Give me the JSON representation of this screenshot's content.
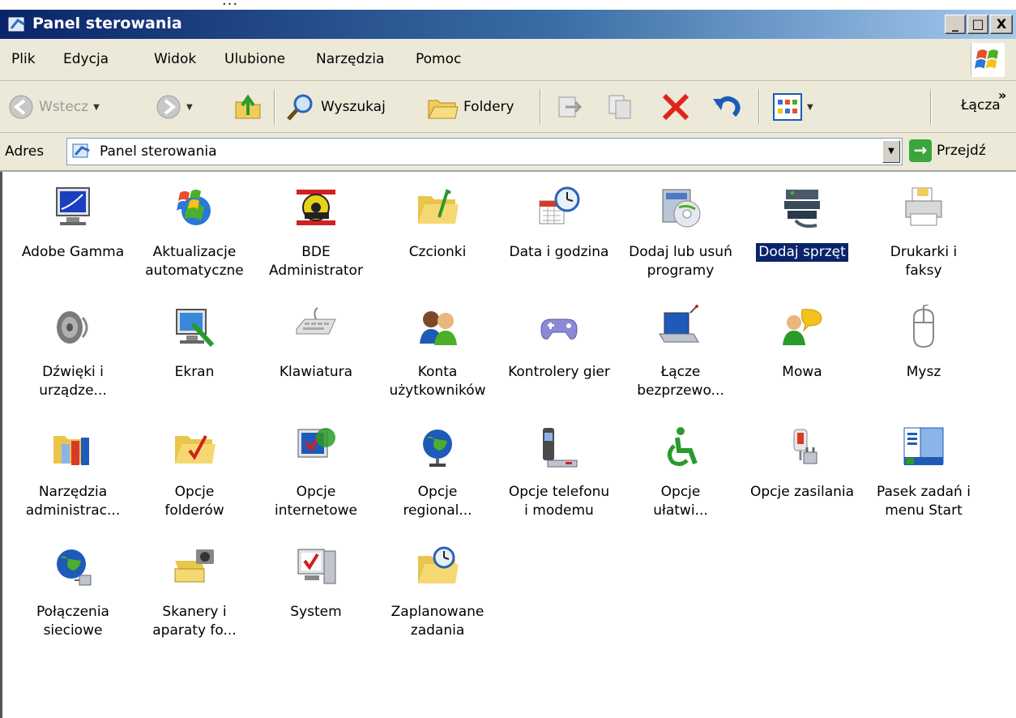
{
  "window": {
    "title": "Panel sterowania"
  },
  "window_controls": {
    "minimize": "_",
    "maximize": "□",
    "close": "X"
  },
  "menu": [
    "Plik",
    "Edycja",
    "Widok",
    "Ulubione",
    "Narzędzia",
    "Pomoc"
  ],
  "toolbar": {
    "back": "Wstecz",
    "search": "Wyszukaj",
    "folders": "Foldery",
    "links": "Łącza",
    "chevron": "»"
  },
  "address": {
    "label": "Adres",
    "value": "Panel sterowania",
    "go": "Przejdź"
  },
  "items": [
    {
      "label": "Adobe Gamma",
      "icon": "monitor-icon"
    },
    {
      "label": "Aktualizacje\nautomatyczne",
      "icon": "windows-update-icon"
    },
    {
      "label": "BDE\nAdministrator",
      "icon": "bde-gear-icon"
    },
    {
      "label": "Czcionki",
      "icon": "fonts-folder-icon"
    },
    {
      "label": "Data i godzina",
      "icon": "clock-calendar-icon"
    },
    {
      "label": "Dodaj lub usuń\nprogramy",
      "icon": "add-remove-programs-icon"
    },
    {
      "label": "Dodaj sprzęt",
      "icon": "hardware-icon",
      "selected": true
    },
    {
      "label": "Drukarki i\nfaksy",
      "icon": "printer-icon"
    },
    {
      "label": "Dźwięki i\nurządze...",
      "icon": "speaker-icon"
    },
    {
      "label": "Ekran",
      "icon": "display-icon"
    },
    {
      "label": "Klawiatura",
      "icon": "keyboard-icon"
    },
    {
      "label": "Konta\nużytkowników",
      "icon": "users-icon"
    },
    {
      "label": "Kontrolery gier",
      "icon": "gamepad-icon"
    },
    {
      "label": "Łącze\nbezprzewo...",
      "icon": "wireless-laptop-icon"
    },
    {
      "label": "Mowa",
      "icon": "speech-icon"
    },
    {
      "label": "Mysz",
      "icon": "mouse-icon"
    },
    {
      "label": "Narzędzia\nadministrac...",
      "icon": "admin-tools-icon"
    },
    {
      "label": "Opcje\nfolderów",
      "icon": "folder-check-icon"
    },
    {
      "label": "Opcje\ninternetowe",
      "icon": "internet-options-icon"
    },
    {
      "label": "Opcje\nregional...",
      "icon": "globe-icon"
    },
    {
      "label": "Opcje telefonu\ni modemu",
      "icon": "phone-modem-icon"
    },
    {
      "label": "Opcje\nułatwi...",
      "icon": "accessibility-icon"
    },
    {
      "label": "Opcje zasilania",
      "icon": "power-plug-icon"
    },
    {
      "label": "Pasek zadań i\nmenu Start",
      "icon": "taskbar-icon"
    },
    {
      "label": "Połączenia\nsieciowe",
      "icon": "network-globe-icon"
    },
    {
      "label": "Skanery i\naparaty fo...",
      "icon": "scanner-camera-icon"
    },
    {
      "label": "System",
      "icon": "system-icon"
    },
    {
      "label": "Zaplanowane\nzadania",
      "icon": "scheduled-tasks-icon"
    }
  ]
}
